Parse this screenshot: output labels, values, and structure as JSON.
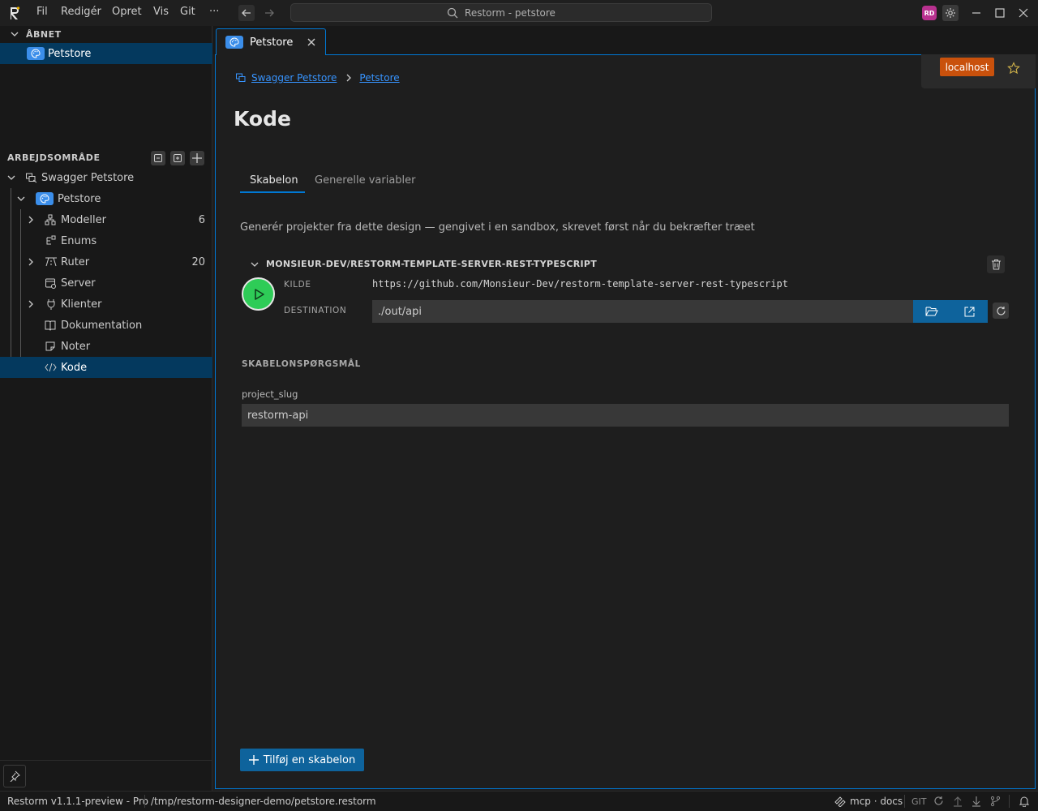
{
  "titlebar": {
    "menu": [
      "Fil",
      "Redigér",
      "Opret",
      "Vis",
      "Git",
      "···"
    ],
    "search": "Restorm - petstore",
    "avatar_initials": "RD"
  },
  "sidebar": {
    "open_header": "ÅBNET",
    "open_item": "Petstore",
    "workspace_header": "ARBEJDSOMRÅDE",
    "tree": [
      {
        "label": "Swagger Petstore"
      },
      {
        "label": "Petstore"
      },
      {
        "label": "Modeller",
        "count": "6"
      },
      {
        "label": "Enums"
      },
      {
        "label": "Ruter",
        "count": "20"
      },
      {
        "label": "Server"
      },
      {
        "label": "Klienter"
      },
      {
        "label": "Dokumentation"
      },
      {
        "label": "Noter"
      },
      {
        "label": "Kode"
      }
    ]
  },
  "tab": {
    "label": "Petstore"
  },
  "breadcrumb": {
    "root": "Swagger Petstore",
    "leaf": "Petstore"
  },
  "env_label": "localhost",
  "page_title": "Kode",
  "subtabs": [
    "Skabelon",
    "Generelle variabler"
  ],
  "description": "Generér projekter fra dette design — gengivet i en sandbox, skrevet først når du bekræfter træet",
  "template": {
    "name": "MONSIEUR-DEV/RESTORM-TEMPLATE-SERVER-REST-TYPESCRIPT",
    "source_label": "KILDE",
    "source_value": "https://github.com/Monsieur-Dev/restorm-template-server-rest-typescript",
    "destination_label": "DESTINATION",
    "destination_value": "./out/api"
  },
  "questions": {
    "header": "SKABELONSPØRGSMÅL",
    "field_label": "project_slug",
    "field_value": "restorm-api"
  },
  "add_button": "Tilføj en skabelon",
  "statusbar": {
    "version": "Restorm v1.1.1-preview - Pro",
    "path": "/tmp/restorm-designer-demo/petstore.restorm",
    "mcp": "mcp · docs",
    "git": "GIT"
  },
  "colors": {
    "accent": "#0078d4",
    "env": "#c9510c",
    "run": "#2ecc57",
    "selected": "#04395e"
  }
}
